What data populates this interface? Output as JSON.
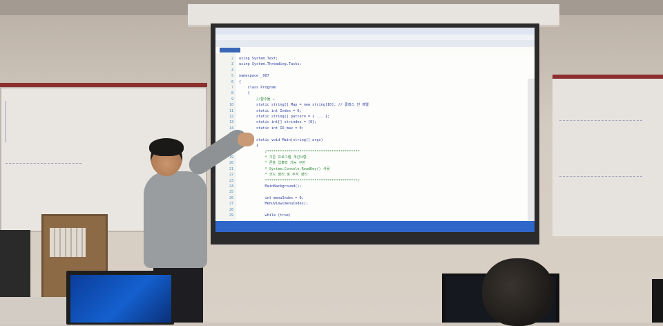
{
  "scene": {
    "screen_code_lines": [
      "using System.Text;",
      "using System.Threading.Tasks;",
      "",
      "namespace _007",
      "{",
      "    class Program",
      "    {",
      "        //함수들 ←",
      "        static string[] Map = new string[10]; // 클래스 안 배열",
      "        static int Index = 0;",
      "        static string[] pattern = { ... };",
      "        static int[] strindex = {0};",
      "        static int ID_max = 0;",
      "",
      "        static void Main(string[] args)",
      "        {",
      "            /*******************************************",
      "            * 기존 프로그램 개선사항",
      "            * 콘솔 입출력 기능 구현",
      "            * System.Console.ReadKey() 사용",
      "            * 코드 정리 및 주석 정리",
      "            *******************************************/",
      "            MainBackground();",
      "",
      "            int menuIndex = 0;",
      "            MenuView(menuIndex);",
      "",
      "            while (true)"
    ],
    "line_numbers": [
      "2",
      "3",
      "4",
      "5",
      "6",
      "7",
      "8",
      "9",
      "10",
      "11",
      "12",
      "13",
      "14",
      "15",
      "16",
      "17",
      "18",
      "19",
      "20",
      "21",
      "22",
      "23",
      "24",
      "25",
      "26",
      "27",
      "28",
      "29"
    ],
    "colors": {
      "editor_keyword": "#2b3d9e",
      "status_bar": "#2f66c9",
      "whiteboard_trim": "#8c2f2f"
    }
  }
}
